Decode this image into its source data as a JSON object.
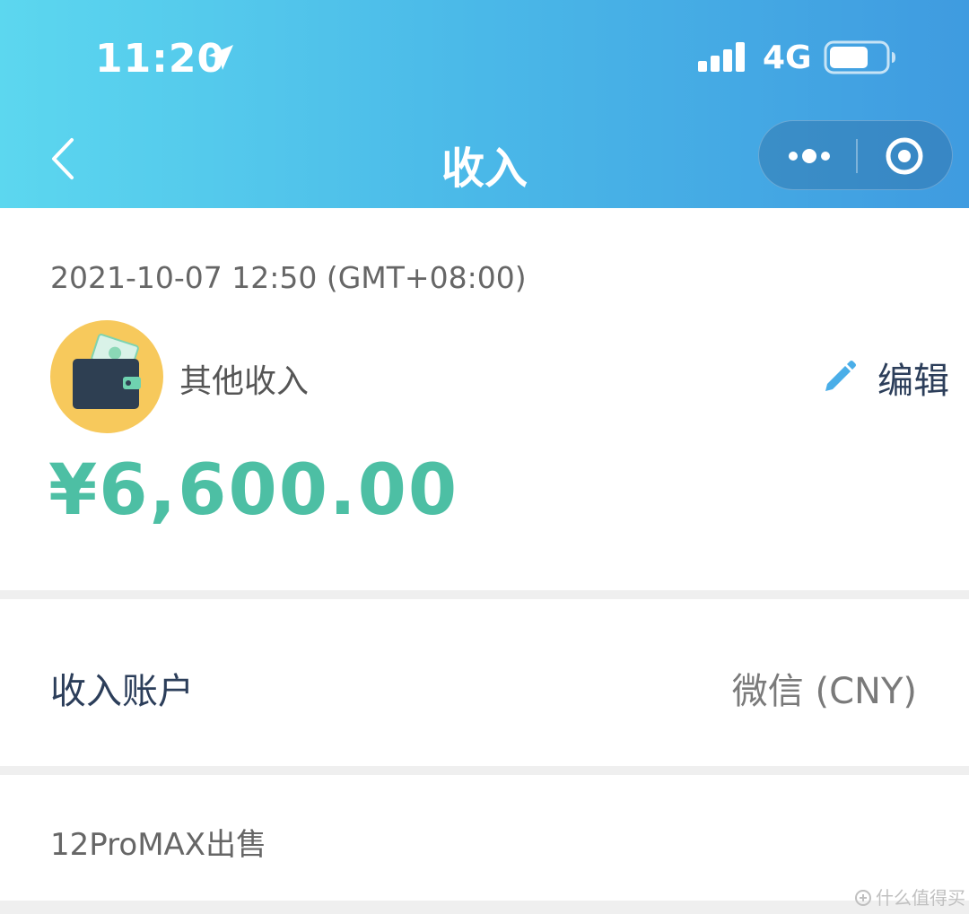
{
  "status_bar": {
    "time": "11:20",
    "network": "4G",
    "battery_level": 0.7,
    "icons": [
      "location-arrow-icon",
      "signal-bars-icon",
      "battery-icon"
    ]
  },
  "nav": {
    "title": "收入",
    "icons": [
      "chevron-left-icon",
      "more-dots-icon",
      "close-target-icon"
    ]
  },
  "record": {
    "datetime": "2021-10-07 12:50 (GMT+08:00)",
    "category_label": "其他收入",
    "category_icon": "wallet-icon",
    "edit_label": "编辑",
    "edit_icon": "pencil-icon",
    "amount": "¥6,600.00"
  },
  "account": {
    "label": "收入账户",
    "value": "微信 (CNY)"
  },
  "note": {
    "text": "12ProMAX出售"
  },
  "watermark": {
    "text": "什么值得买"
  },
  "colors": {
    "header_gradient_start": "#5cd7ef",
    "header_gradient_end": "#3f9be0",
    "amount": "#4dbfa4",
    "label_dark": "#2c3e5a",
    "edit_icon": "#4aaee8",
    "category_bg": "#f7c95c"
  }
}
